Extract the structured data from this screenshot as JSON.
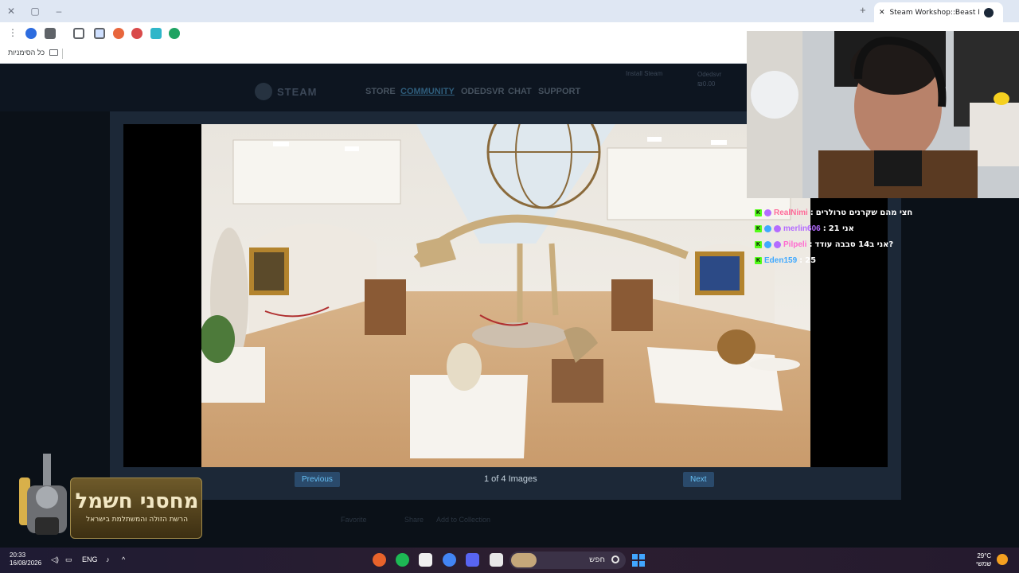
{
  "browser": {
    "tab_title": "Steam Workshop::Beast Museum",
    "url_fragment": "steam",
    "bookmarks_all_label": "כל הסימניות"
  },
  "steam": {
    "logo_text": "STEAM",
    "nav": [
      "STORE",
      "COMMUNITY",
      "ODEDSVR",
      "CHAT",
      "SUPPORT"
    ],
    "install_label": "Install Steam",
    "account_name": "Odedsvr",
    "account_balance": "₪0.00",
    "image_counter": "1 of 4 Images",
    "prev_label": "Previous",
    "next_label": "Next",
    "below_actions": [
      "Favorite",
      "Share",
      "Add to Collection"
    ]
  },
  "chat": [
    {
      "name": "RealNimi",
      "message": "חצי מהם שקרנים טרולרים",
      "color": "#ff6b9a"
    },
    {
      "name": "merlin606",
      "message": "אני 21",
      "color": "#b46bff"
    },
    {
      "name": "Pilpeli",
      "message": "אני ב14 סבבה עודד?",
      "color": "#ff6bd0"
    },
    {
      "name": "Eden159",
      "message": "25",
      "color": "#3fa9ff"
    }
  ],
  "sponsor": {
    "title": "מחסני חשמל",
    "subtitle": "הרשת הזולה והמשתלמת בישראל"
  },
  "taskbar": {
    "time": "20:33",
    "date": "16/08/2026",
    "language": "ENG",
    "search_label": "חפש",
    "temperature": "29°C",
    "weather_label": "שמשי"
  }
}
